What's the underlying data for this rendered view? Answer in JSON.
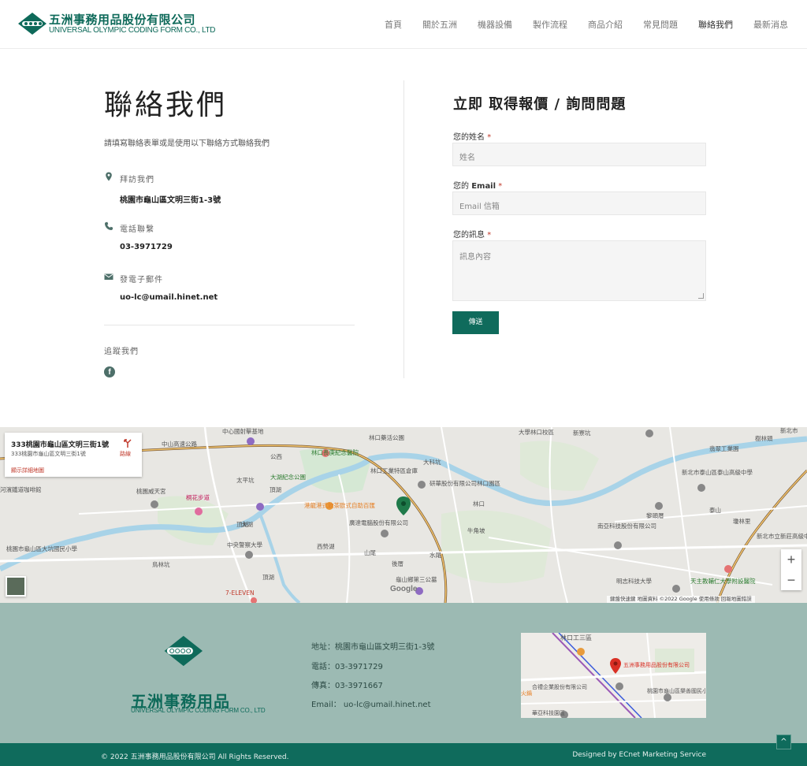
{
  "header": {
    "logo_cn": "五洲事務用品股份有限公司",
    "logo_en": "UNIVERSAL OLYMPIC CODING FORM CO., LTD",
    "nav": [
      {
        "label": "首頁"
      },
      {
        "label": "關於五洲"
      },
      {
        "label": "機器設備"
      },
      {
        "label": "製作流程"
      },
      {
        "label": "商品介紹"
      },
      {
        "label": "常見問題"
      },
      {
        "label": "聯絡我們"
      },
      {
        "label": "最新消息"
      }
    ],
    "active_nav": "聯絡我們"
  },
  "contact": {
    "title": "聯絡我們",
    "intro": "請填寫聯絡表單或是使用以下聯絡方式聯絡我們",
    "visit_label": "拜訪我們",
    "address": "桃園市龜山區文明三街1-3號",
    "phone_label": "電話聯繫",
    "phone": "03-3971729",
    "email_label": "發電子郵件",
    "email": "uo-lc@umail.hinet.net",
    "follow_label": "追蹤我們",
    "facebook_icon_text": "f"
  },
  "form": {
    "title": "立即 取得報價 / 詢問問題",
    "name_label": "您的姓名",
    "name_placeholder": "姓名",
    "email_label_prefix": "您的 ",
    "email_label_bold": "Email",
    "email_placeholder": "Email 信箱",
    "message_label": "您的訊息",
    "message_placeholder": "訊息內容",
    "required_mark": "*",
    "submit": "傳送"
  },
  "map": {
    "card_title": "333桃園市龜山區文明三街1號",
    "card_sub": "333桃園市龜山區文明三街1號",
    "card_link": "顯示詳細地圖",
    "route_label": "路線",
    "zoom_in": "+",
    "zoom_out": "−",
    "google": "Google",
    "footer_text": "鍵盤快速鍵   地圖資料 ©2022 Google   使用條款   回報地圖錯誤",
    "labels": [
      "中心國射擊基地",
      "林口藥活公園",
      "大學林口校區",
      "新寮坑",
      "樹林頭",
      "新北市",
      "中山高速公路",
      "林口長庚紀念醫院",
      "大科坑",
      "翡翠工業園",
      "公西",
      "研華股份有限公司林口園區",
      "大湖紀念公園",
      "林口工業特區倉庫",
      "新北市泰山區泰山高級中學",
      "桃園威天宮",
      "桐花步道",
      "頂湖",
      "港龍港式飲茶歐式自助百匯",
      "太平坑",
      "泰山",
      "河濱鐵道咖啡館",
      "頂湖",
      "廣達電腦股份有限公司",
      "牛角坡",
      "黎頭厝",
      "瓊林里",
      "大湖",
      "桃園市龜山區大坑國民小學",
      "南亞科技股份有限公司",
      "中央警察大學",
      "西勢湖",
      "山尾",
      "水尾",
      "鳥林坑",
      "後厝",
      "林口",
      "明志科技大學",
      "頂湖",
      "龜山鄉第三公墓",
      "7-ELEVEN",
      "天主教輔仁大學附設醫院",
      "新北市立新莊高級中學"
    ]
  },
  "footer": {
    "logo_cn": "五洲事務用品",
    "logo_en": "UNIVERSAL OLYMPIC CODING FORM CO., LTD",
    "address": "地址：桃園市龜山區文明三街1-3號",
    "phone": "電話：03-3971729",
    "fax": "傳真：03-3971667",
    "email": "Email： uo-lc@umail.hinet.net",
    "mini_map_labels": [
      "林口工三區",
      "五洲事務用品股份有限公司",
      "合禮企業股份有限公司",
      "桃園市龜山區樂善國民小學",
      "華亞科技園區",
      "火鍋"
    ],
    "copyright": "© 2022 五洲事務用品股份有限公司 All Rights Reserved.",
    "designed_by": "Designed by ECnet Marketing Service",
    "to_top": "^"
  },
  "colors": {
    "brand": "#0f6b5c",
    "footer_bg": "#9cbab3",
    "required": "#c0392b"
  },
  "icons": {
    "address": "map-marker-icon",
    "phone": "phone-icon",
    "email": "envelope-icon",
    "social": "facebook-icon"
  }
}
